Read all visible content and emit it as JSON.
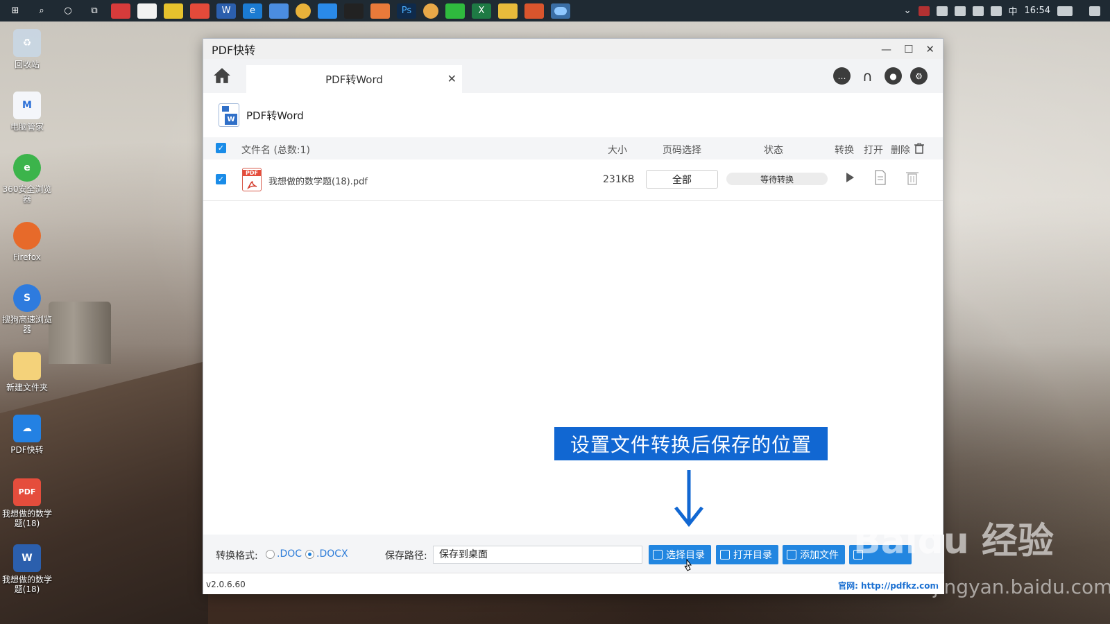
{
  "taskbar": {
    "clock": "16:54",
    "ime": "中"
  },
  "desktop": {
    "icons": [
      {
        "label": "回收站"
      },
      {
        "label": "电脑管家"
      },
      {
        "label": "360安全浏览器"
      },
      {
        "label": "Firefox"
      },
      {
        "label": "搜狗高速浏览器"
      },
      {
        "label": "新建文件夹"
      },
      {
        "label": "PDF快转"
      },
      {
        "label": "我想做的数学题(18)"
      },
      {
        "label": "我想做的数学题(18)"
      }
    ]
  },
  "window": {
    "title": "PDF快转",
    "tab": {
      "label": "PDF转Word",
      "close": "✕"
    },
    "header": {
      "title": "PDF转Word",
      "icon_badge": "W"
    },
    "table": {
      "columns": {
        "filename": "文件名 (总数:1)",
        "size": "大小",
        "pages": "页码选择",
        "status": "状态",
        "convert": "转换",
        "open": "打开",
        "delete": "删除"
      },
      "rows": [
        {
          "filename": "我想做的数学题(18).pdf",
          "size": "231KB",
          "pages": "全部",
          "status": "等待转换",
          "icon_label": "PDF"
        }
      ]
    },
    "annotation": "设置文件转换后保存的位置",
    "bottom": {
      "format_label": "转换格式:",
      "format_doc": ".DOC",
      "format_docx": ".DOCX",
      "selected_format": ".DOCX",
      "save_label": "保存路径:",
      "save_value": "保存到桌面",
      "btn_choose_dir": "选择目录",
      "btn_open_dir": "打开目录",
      "btn_add_file": "添加文件"
    },
    "footer": {
      "version": "v2.0.6.60",
      "site": "官网: http://pdfkz.com"
    }
  },
  "watermark": {
    "text": "Baidu 经验",
    "sub": "jingyan.baidu.com"
  },
  "colors": {
    "accent": "#2286e0",
    "annotation_bg": "#1167d2",
    "pdf_red": "#e54d3c"
  }
}
